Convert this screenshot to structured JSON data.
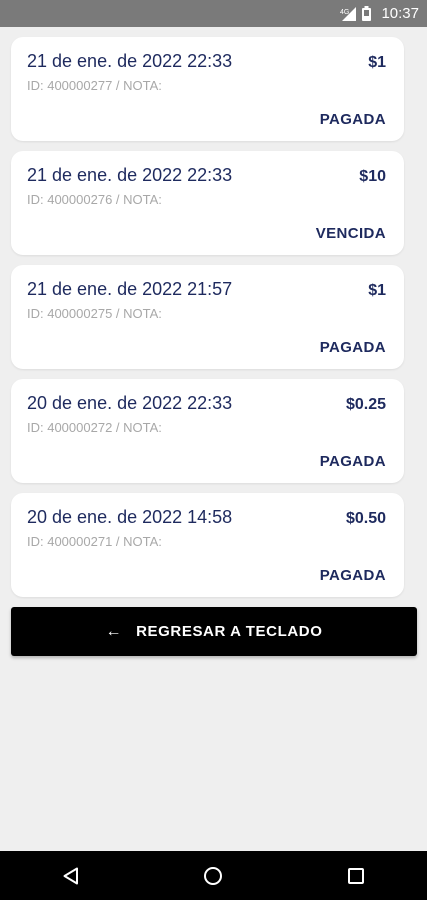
{
  "status_bar": {
    "network": "4G",
    "time": "10:37"
  },
  "invoices": [
    {
      "date": "21 de ene. de 2022 22:33",
      "meta": "ID: 400000277 / NOTA:",
      "amount": "$1",
      "status": "PAGADA"
    },
    {
      "date": "21 de ene. de 2022 22:33",
      "meta": "ID: 400000276 / NOTA:",
      "amount": "$10",
      "status": "VENCIDA"
    },
    {
      "date": "21 de ene. de 2022 21:57",
      "meta": "ID: 400000275 / NOTA:",
      "amount": "$1",
      "status": "PAGADA"
    },
    {
      "date": "20 de ene. de 2022 22:33",
      "meta": "ID: 400000272 / NOTA:",
      "amount": "$0.25",
      "status": "PAGADA"
    },
    {
      "date": "20 de ene. de 2022 14:58",
      "meta": "ID: 400000271 / NOTA:",
      "amount": "$0.50",
      "status": "PAGADA"
    }
  ],
  "back_button": {
    "label": "REGRESAR A TECLADO",
    "icon": "arrow-left-icon"
  },
  "nav_bar": {
    "icons": [
      "back-triangle-icon",
      "home-circle-icon",
      "recents-square-icon"
    ]
  },
  "colors": {
    "accent": "#1e2a5e",
    "muted": "#a8a8a8",
    "background": "#efefef",
    "status_bar": "#7a7a7a"
  }
}
